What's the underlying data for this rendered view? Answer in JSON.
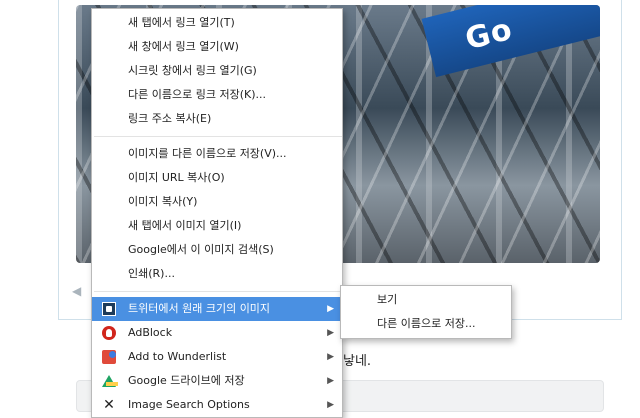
{
  "photo": {
    "sign_text": "Go"
  },
  "tweet_text": "낳네.",
  "context_menu": {
    "group1": [
      "새 탭에서 링크 열기(T)",
      "새 창에서 링크 열기(W)",
      "시크릿 창에서 링크 열기(G)",
      "다른 이름으로 링크 저장(K)...",
      "링크 주소 복사(E)"
    ],
    "group2": [
      "이미지를 다른 이름으로 저장(V)...",
      "이미지 URL 복사(O)",
      "이미지 복사(Y)",
      "새 탭에서 이미지 열기(I)",
      "Google에서 이 이미지 검색(S)",
      "인쇄(R)..."
    ],
    "extensions": [
      {
        "label": "트위터에서 원래 크기의 이미지",
        "icon": "twitter-image-icon",
        "selected": true
      },
      {
        "label": "AdBlock",
        "icon": "adblock-icon",
        "selected": false
      },
      {
        "label": "Add to Wunderlist",
        "icon": "wunderlist-icon",
        "selected": false
      },
      {
        "label": "Google 드라이브에 저장",
        "icon": "google-drive-icon",
        "selected": false
      },
      {
        "label": "Image Search Options",
        "icon": "image-search-icon",
        "selected": false
      }
    ],
    "submenu_arrow": "▶"
  },
  "submenu": {
    "items": [
      "보기",
      "다른 이름으로 저장..."
    ]
  },
  "colors": {
    "selected_bg": "#4a90e2",
    "card_border": "#cfe0ea"
  }
}
